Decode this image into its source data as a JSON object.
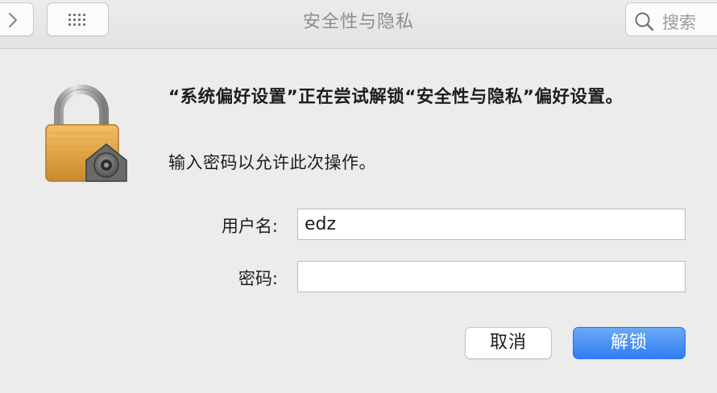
{
  "toolbar": {
    "title": "安全性与隐私",
    "search_placeholder": "搜索",
    "back_icon": "chevron-right-icon",
    "grid_icon": "grid-icon"
  },
  "dialog": {
    "message": "“系统偏好设置”正在尝试解锁“安全性与隐私”偏好设置。",
    "subtext": "输入密码以允许此次操作。",
    "username_label": "用户名:",
    "username_value": "edz",
    "password_label": "密码:",
    "password_value": "",
    "cancel_label": "取消",
    "unlock_label": "解锁",
    "icon": "padlock-icon"
  },
  "colors": {
    "accent": "#2f7df2",
    "background": "#ececec"
  }
}
